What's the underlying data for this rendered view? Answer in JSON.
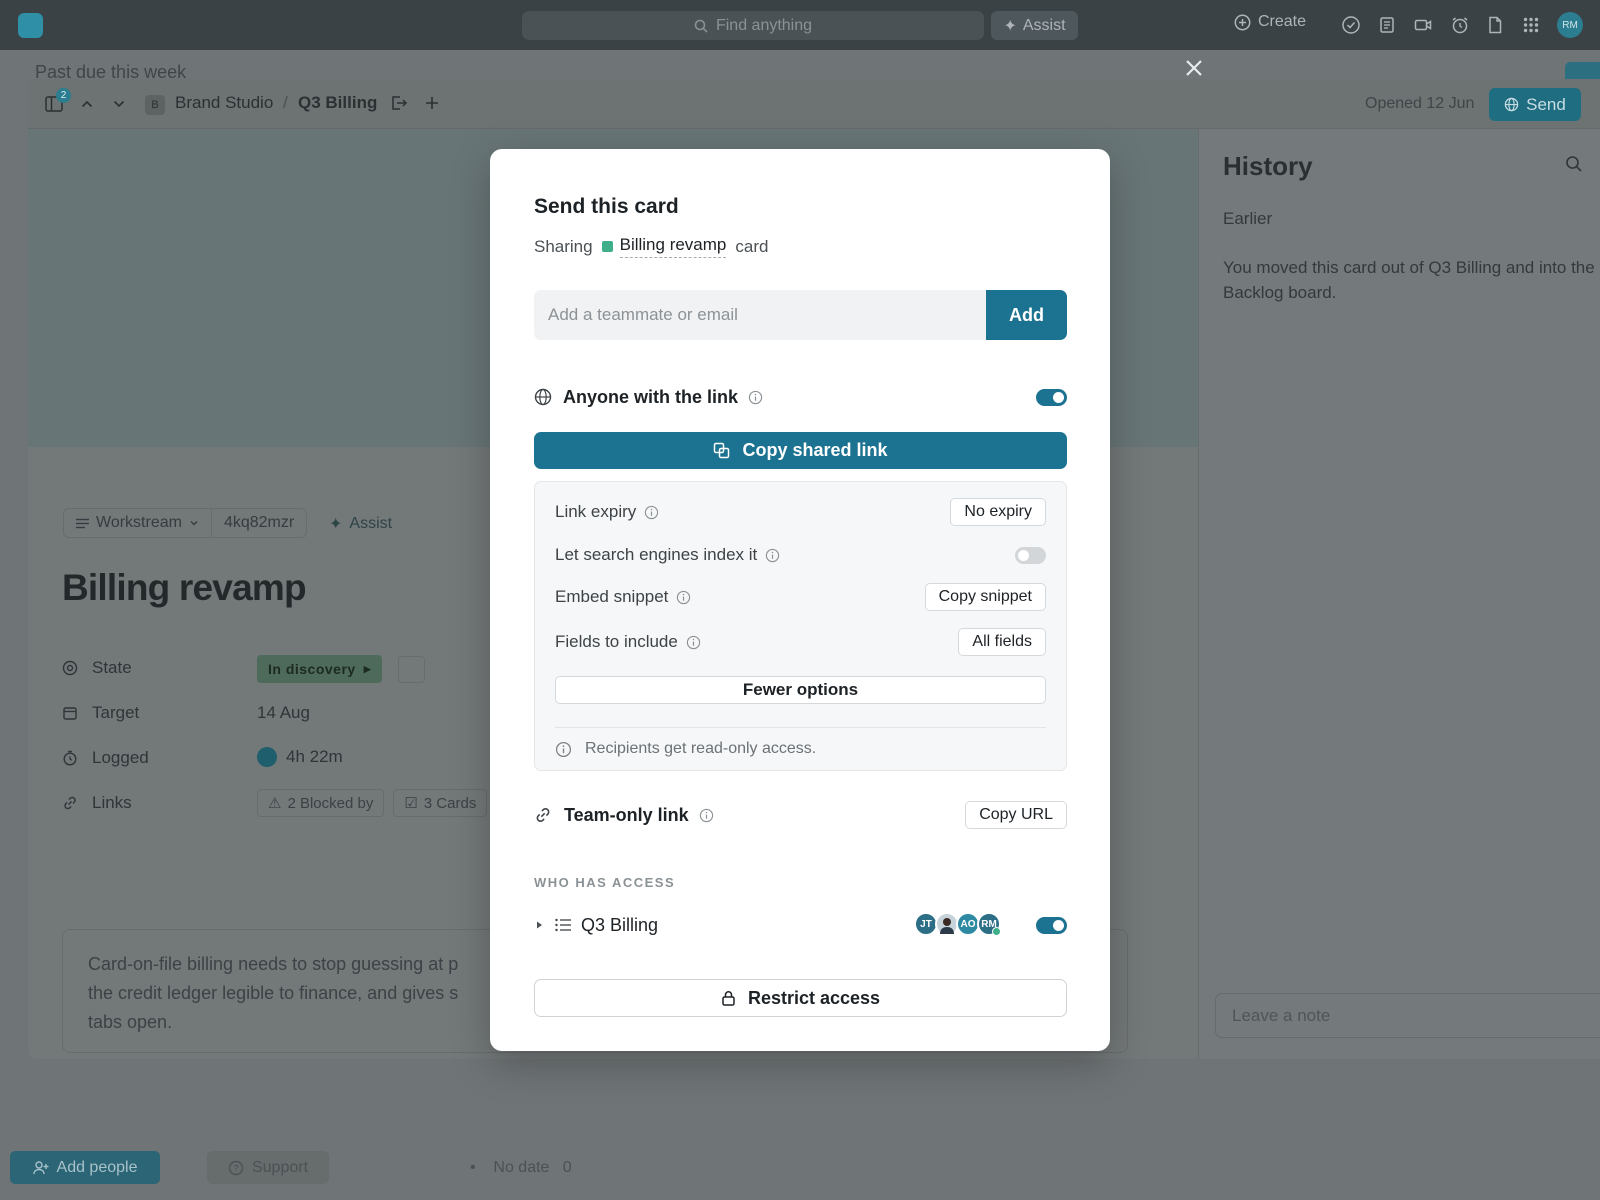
{
  "topbar": {
    "search_placeholder": "Find anything",
    "assist_label": "Assist",
    "create_label": "Create",
    "user_initials": "RM"
  },
  "background": {
    "peek_heading": "Past due this week"
  },
  "card_header": {
    "panel_badge": "2",
    "workspace_initial": "B",
    "workspace": "Brand Studio",
    "separator": "/",
    "board": "Q3 Billing",
    "opened": "Opened 12 Jun",
    "send_label": "Send"
  },
  "card": {
    "workstream_label": "Workstream",
    "card_id": "4kq82mzr",
    "assist_label": "Assist",
    "title": "Billing revamp",
    "properties": {
      "state_label": "State",
      "state_value": "In discovery",
      "target_label": "Target",
      "target_value": "14 Aug",
      "logged_label": "Logged",
      "logged_value": "4h 22m",
      "links_label": "Links",
      "blocked_by": "2 Blocked by",
      "cards": "3 Cards"
    },
    "description_lines": [
      "Card-on-file billing needs to stop guessing at p",
      "the credit ledger legible to finance, and gives s",
      "tabs open."
    ]
  },
  "history": {
    "title": "History",
    "group": "Earlier",
    "entry": "You moved this card out of Q3 Billing and into the Backlog board.",
    "note_placeholder": "Leave a note"
  },
  "bottom": {
    "add_people": "Add people",
    "support": "Support",
    "no_date": "No date",
    "no_date_count": "0"
  },
  "modal": {
    "title": "Send this card",
    "sharing_prefix": "Sharing",
    "card_ref": "Billing revamp",
    "sharing_suffix": "card",
    "invite_placeholder": "Add a teammate or email",
    "add_label": "Add",
    "public_label": "Anyone with the link",
    "public_enabled": true,
    "copy_link_label": "Copy shared link",
    "options": {
      "expiry_label": "Link expiry",
      "expiry_value": "No expiry",
      "index_label": "Let search engines index it",
      "index_enabled": false,
      "embed_label": "Embed snippet",
      "embed_button": "Copy snippet",
      "fields_label": "Fields to include",
      "fields_value": "All fields",
      "fewer_label": "Fewer options",
      "readonly_note": "Recipients get read-only access."
    },
    "team_label": "Team-only link",
    "copy_url_label": "Copy URL",
    "access_header": "WHO HAS ACCESS",
    "access_group": "Q3 Billing",
    "access_avatars": [
      "JT",
      "",
      "AO",
      "RM"
    ],
    "access_enabled": true,
    "restrict_label": "Restrict access"
  },
  "colors": {
    "accent": "#1c7291",
    "online": "#3fae8a",
    "state_chip": "#4e6a5a"
  }
}
